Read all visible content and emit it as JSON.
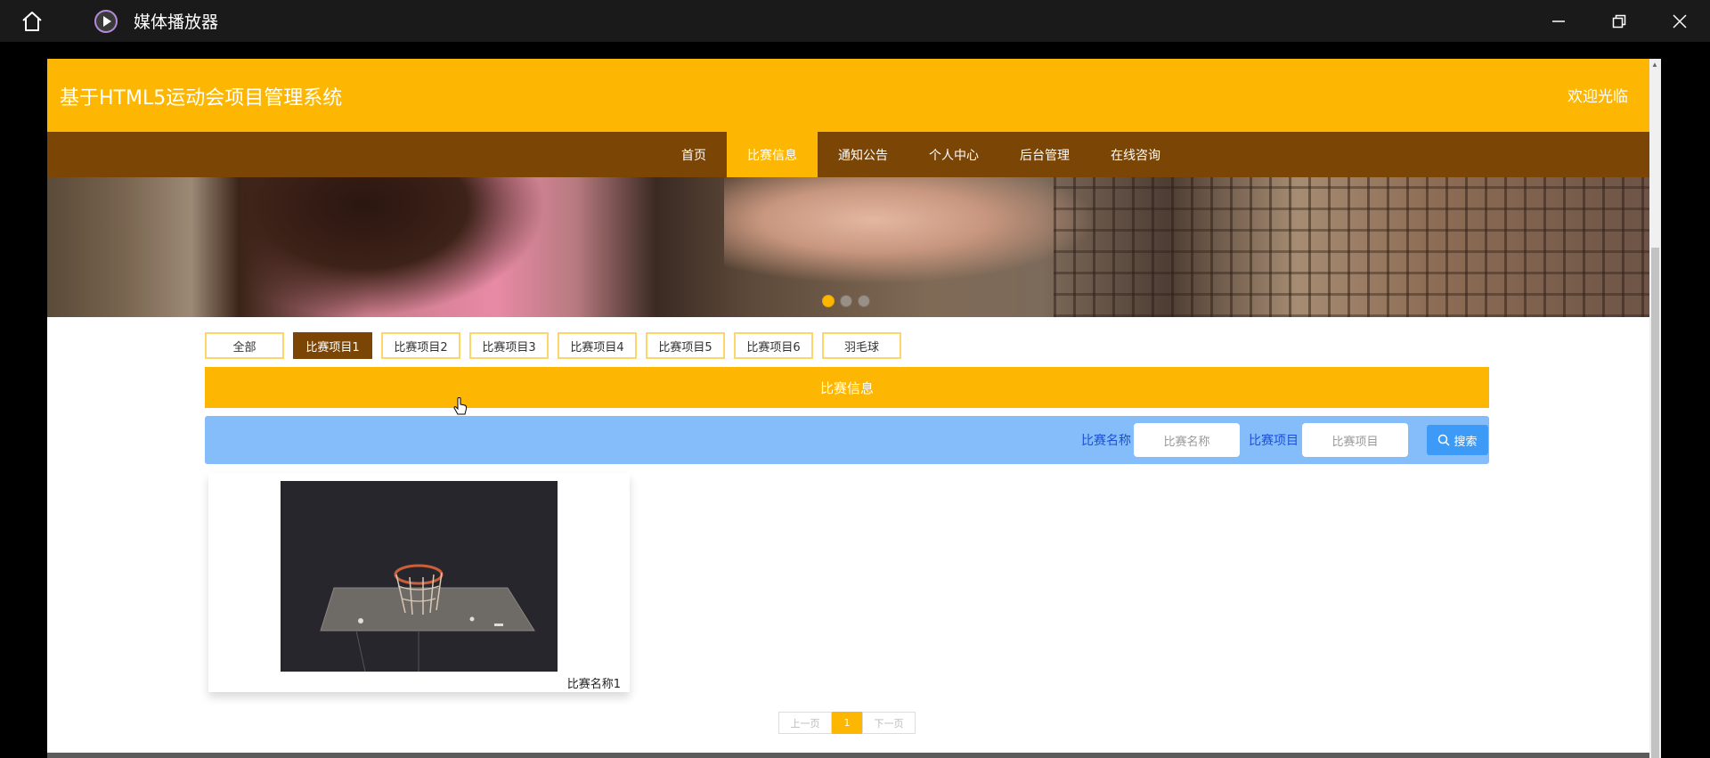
{
  "window": {
    "title": "媒体播放器"
  },
  "site": {
    "title": "基于HTML5运动会项目管理系统",
    "welcome": "欢迎光临"
  },
  "nav": {
    "items": [
      "首页",
      "比赛信息",
      "通知公告",
      "个人中心",
      "后台管理",
      "在线咨询"
    ],
    "active_index": 1
  },
  "banner": {
    "dots_count": 3,
    "active_dot": 0
  },
  "filters": {
    "items": [
      "全部",
      "比赛项目1",
      "比赛项目2",
      "比赛项目3",
      "比赛项目4",
      "比赛项目5",
      "比赛项目6",
      "羽毛球"
    ],
    "active_index": 1
  },
  "section": {
    "title": "比赛信息"
  },
  "search": {
    "name_label": "比赛名称",
    "name_placeholder": "比赛名称",
    "item_label": "比赛项目",
    "item_placeholder": "比赛项目",
    "button_label": "搜索"
  },
  "cards": [
    {
      "name": "比赛名称1"
    }
  ],
  "pager": {
    "prev": "上一页",
    "current": "1",
    "next": "下一页"
  },
  "colors": {
    "brand_yellow": "#fdb703",
    "nav_brown": "#7a4505",
    "search_blue": "#84bdfa",
    "button_blue": "#3d9bf7"
  }
}
